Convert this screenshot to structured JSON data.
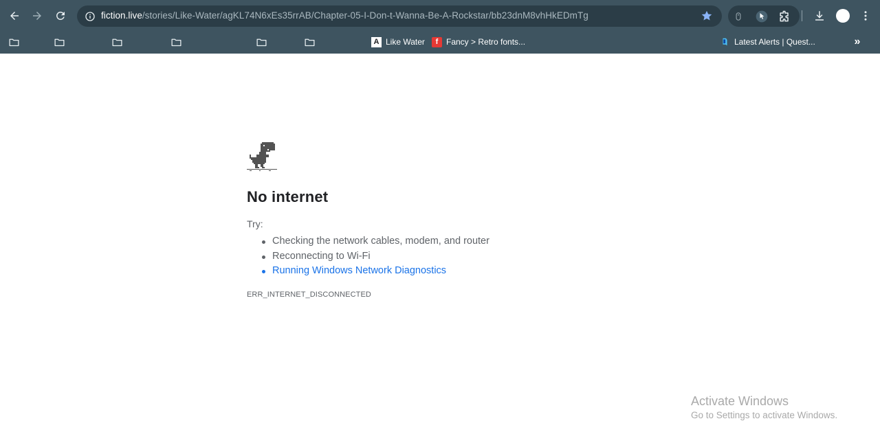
{
  "browser": {
    "url_host": "fiction.live",
    "url_path": "/stories/Like-Water/agKL74N6xEs35rrAB/Chapter-05-I-Don-t-Wanna-Be-A-Rockstar/bb23dnM8vhHkEDmTg",
    "star_color": "#8ab4f8"
  },
  "bookmarks": {
    "folders": [
      "folder-icon",
      "folder-icon",
      "folder-icon",
      "folder-icon",
      "folder-icon",
      "folder-icon"
    ],
    "items": [
      {
        "label": "Like Water",
        "icon": "a-letter-icon"
      },
      {
        "label": "Fancy > Retro fonts...",
        "icon": "fancy-logo-icon"
      },
      {
        "label": "Latest Alerts | Quest...",
        "icon": "quest-logo-icon"
      }
    ]
  },
  "page": {
    "title": "No internet",
    "try_label": "Try:",
    "suggestions": [
      "Checking the network cables, modem, and router",
      "Reconnecting to Wi-Fi",
      "Running Windows Network Diagnostics"
    ],
    "error_code": "ERR_INTERNET_DISCONNECTED"
  },
  "watermark": {
    "line1": "Activate Windows",
    "line2": "Go to Settings to activate Windows."
  },
  "colors": {
    "chrome": "#3e5460",
    "omnibox": "#2b3d47",
    "link": "#1a73e8"
  }
}
